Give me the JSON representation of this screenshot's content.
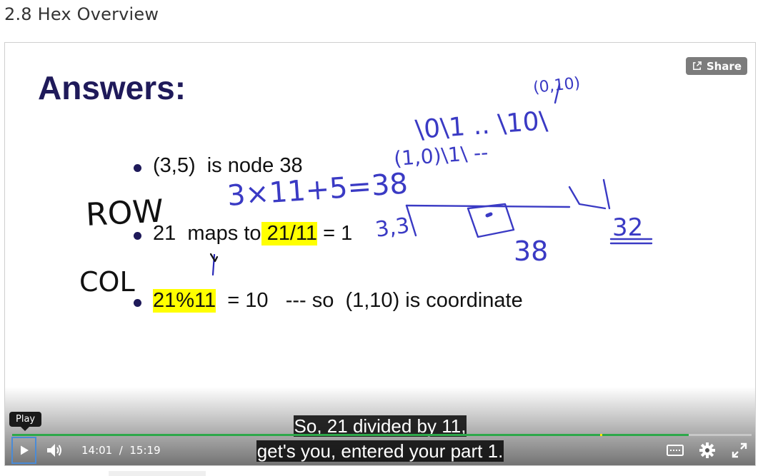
{
  "page": {
    "title": "2.8 Hex Overview"
  },
  "player": {
    "share_label": "Share",
    "tooltip": "Play",
    "time_current": "14:01",
    "time_separator": "/",
    "time_total": "15:19",
    "progress_fraction": 0.915,
    "marker_fraction": 0.795,
    "accent_color": "#2ea84a",
    "caption_lines": [
      "So, 21 divided by 11,",
      "get's you, entered your part 1."
    ]
  },
  "slide": {
    "title": "Answers:",
    "bullets": [
      {
        "parts": [
          {
            "text": "(3,5)  is node 38",
            "highlight": false
          }
        ]
      },
      {
        "parts": [
          {
            "text": "21  maps to",
            "highlight": false
          },
          {
            "text": " 21/11",
            "highlight": true
          },
          {
            "text": " = 1",
            "highlight": false
          }
        ]
      },
      {
        "parts": [
          {
            "text": "21%11",
            "highlight": true
          },
          {
            "text": "  = 10   --- so  (1,10) is coordinate",
            "highlight": false
          }
        ]
      }
    ],
    "handwriting": {
      "row": "ROW",
      "col": "COL",
      "equation": "3×11+5=38",
      "num_38": "38",
      "num_32": "32",
      "num_33": "3,3",
      "top_label": "(0,10)",
      "seq1": "\\0\\1 .. \\10\\",
      "seq2": "(1,0)\\1\\ --"
    }
  },
  "icons": {
    "share": "share-icon",
    "play": "play-icon",
    "volume": "volume-icon",
    "captions": "captions-icon",
    "settings": "gear-icon",
    "fullscreen": "fullscreen-icon"
  }
}
